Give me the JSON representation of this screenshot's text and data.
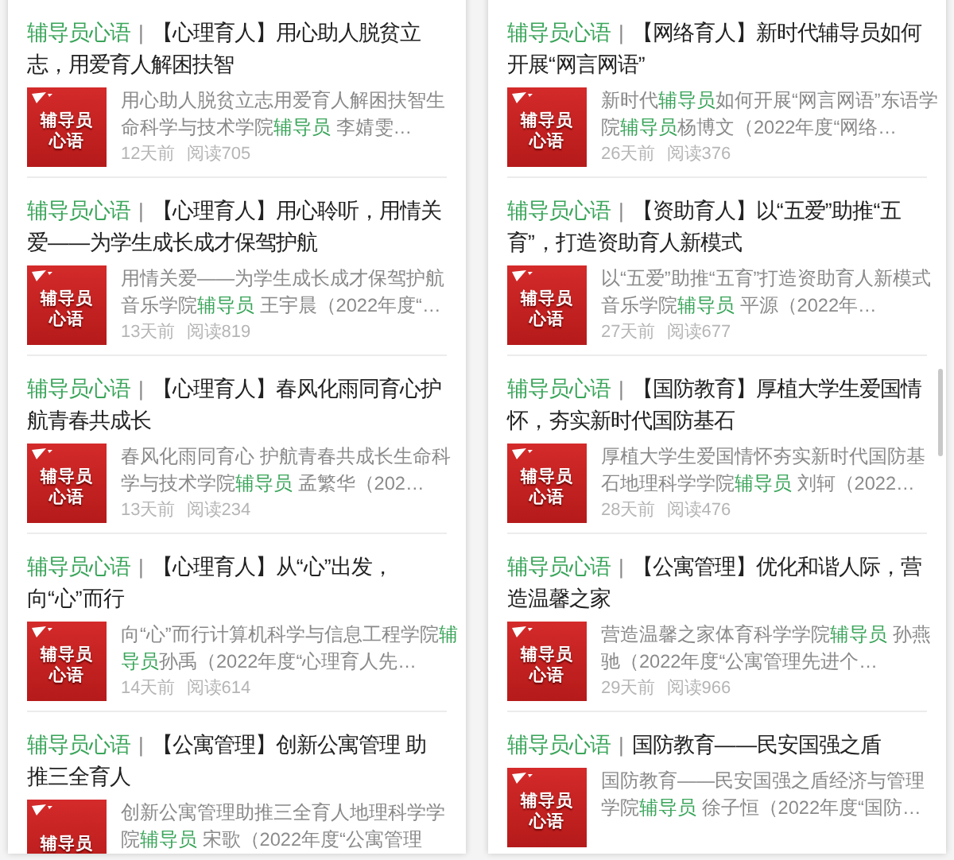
{
  "panels": [
    {
      "scrollbar": false,
      "articles": [
        {
          "column": "辅导员心语",
          "separator": "|",
          "title": "【心理育人】用心助人脱贫立志，用爱育人解困扶智",
          "thumbnail_text": [
            "辅导员",
            "心语"
          ],
          "summary": [
            {
              "text": "用心助人脱贫立志用爱育人解困扶智生命科学与技术学院",
              "highlight": false
            },
            {
              "text": "辅导员",
              "highlight": true
            },
            {
              "text": " 李婧雯…",
              "highlight": false
            }
          ],
          "time": "12天前",
          "reads": "阅读705"
        },
        {
          "column": "辅导员心语",
          "separator": "|",
          "title": "【心理育人】用心聆听，用情关爱——为学生成长成才保驾护航",
          "thumbnail_text": [
            "辅导员",
            "心语"
          ],
          "summary": [
            {
              "text": "用情关爱——为学生成长成才保驾护航音乐学院",
              "highlight": false
            },
            {
              "text": "辅导员",
              "highlight": true
            },
            {
              "text": " 王宇晨（2022年度“…",
              "highlight": false
            }
          ],
          "time": "13天前",
          "reads": "阅读819"
        },
        {
          "column": "辅导员心语",
          "separator": "|",
          "title": "【心理育人】春风化雨同育心护航青春共成长",
          "thumbnail_text": [
            "辅导员",
            "心语"
          ],
          "summary": [
            {
              "text": "春风化雨同育心 护航青春共成长生命科学与技术学院",
              "highlight": false
            },
            {
              "text": "辅导员",
              "highlight": true
            },
            {
              "text": " 孟繁华（202…",
              "highlight": false
            }
          ],
          "time": "13天前",
          "reads": "阅读234"
        },
        {
          "column": "辅导员心语",
          "separator": "|",
          "title": "【心理育人】从“心”出发，向“心”而行",
          "thumbnail_text": [
            "辅导员",
            "心语"
          ],
          "summary": [
            {
              "text": "向“心”而行计算机科学与信息工程学院",
              "highlight": false
            },
            {
              "text": "辅导员",
              "highlight": true
            },
            {
              "text": "孙禹（2022年度“心理育人先…",
              "highlight": false
            }
          ],
          "time": "14天前",
          "reads": "阅读614"
        },
        {
          "column": "辅导员心语",
          "separator": "|",
          "title": "【公寓管理】创新公寓管理 助推三全育人",
          "thumbnail_text": [
            "辅导员"
          ],
          "summary": [
            {
              "text": "创新公寓管理助推三全育人地理科学学院",
              "highlight": false
            },
            {
              "text": "辅导员",
              "highlight": true
            },
            {
              "text": " 宋歌（2022年度“公寓管理",
              "highlight": false
            }
          ]
        }
      ]
    },
    {
      "scrollbar": true,
      "articles": [
        {
          "column": "辅导员心语",
          "separator": "|",
          "title": "【网络育人】新时代辅导员如何开展“网言网语”",
          "thumbnail_text": [
            "辅导员",
            "心语"
          ],
          "summary": [
            {
              "text": "新时代",
              "highlight": false
            },
            {
              "text": "辅导员",
              "highlight": true
            },
            {
              "text": "如何开展“网言网语”东语学院",
              "highlight": false
            },
            {
              "text": "辅导员",
              "highlight": true
            },
            {
              "text": "杨博文（2022年度“网络…",
              "highlight": false
            }
          ],
          "time": "26天前",
          "reads": "阅读376"
        },
        {
          "column": "辅导员心语",
          "separator": "|",
          "title": "【资助育人】以“五爱”助推“五育”，打造资助育人新模式",
          "thumbnail_text": [
            "辅导员",
            "心语"
          ],
          "summary": [
            {
              "text": "以“五爱”助推“五育”打造资助育人新模式音乐学院",
              "highlight": false
            },
            {
              "text": "辅导员",
              "highlight": true
            },
            {
              "text": " 平源（2022年…",
              "highlight": false
            }
          ],
          "time": "27天前",
          "reads": "阅读677"
        },
        {
          "column": "辅导员心语",
          "separator": "|",
          "title": "【国防教育】厚植大学生爱国情怀，夯实新时代国防基石",
          "thumbnail_text": [
            "辅导员",
            "心语"
          ],
          "summary": [
            {
              "text": "厚植大学生爱国情怀夯实新时代国防基石地理科学学院",
              "highlight": false
            },
            {
              "text": "辅导员",
              "highlight": true
            },
            {
              "text": " 刘轲（2022…",
              "highlight": false
            }
          ],
          "time": "28天前",
          "reads": "阅读476"
        },
        {
          "column": "辅导员心语",
          "separator": "|",
          "title": "【公寓管理】优化和谐人际，营造温馨之家",
          "thumbnail_text": [
            "辅导员",
            "心语"
          ],
          "summary": [
            {
              "text": "营造温馨之家体育科学学院",
              "highlight": false
            },
            {
              "text": "辅导员",
              "highlight": true
            },
            {
              "text": " 孙燕驰（2022年度“公寓管理先进个…",
              "highlight": false
            }
          ],
          "time": "29天前",
          "reads": "阅读966"
        },
        {
          "column": "辅导员心语",
          "separator": "|",
          "title": "国防教育——民安国强之盾",
          "thumbnail_text": [
            "辅导员",
            "心语"
          ],
          "summary": [
            {
              "text": "国防教育——民安国强之盾经济与管理学院",
              "highlight": false
            },
            {
              "text": "辅导员",
              "highlight": true
            },
            {
              "text": " 徐子恒（2022年度“国防…",
              "highlight": false
            }
          ]
        }
      ]
    }
  ]
}
